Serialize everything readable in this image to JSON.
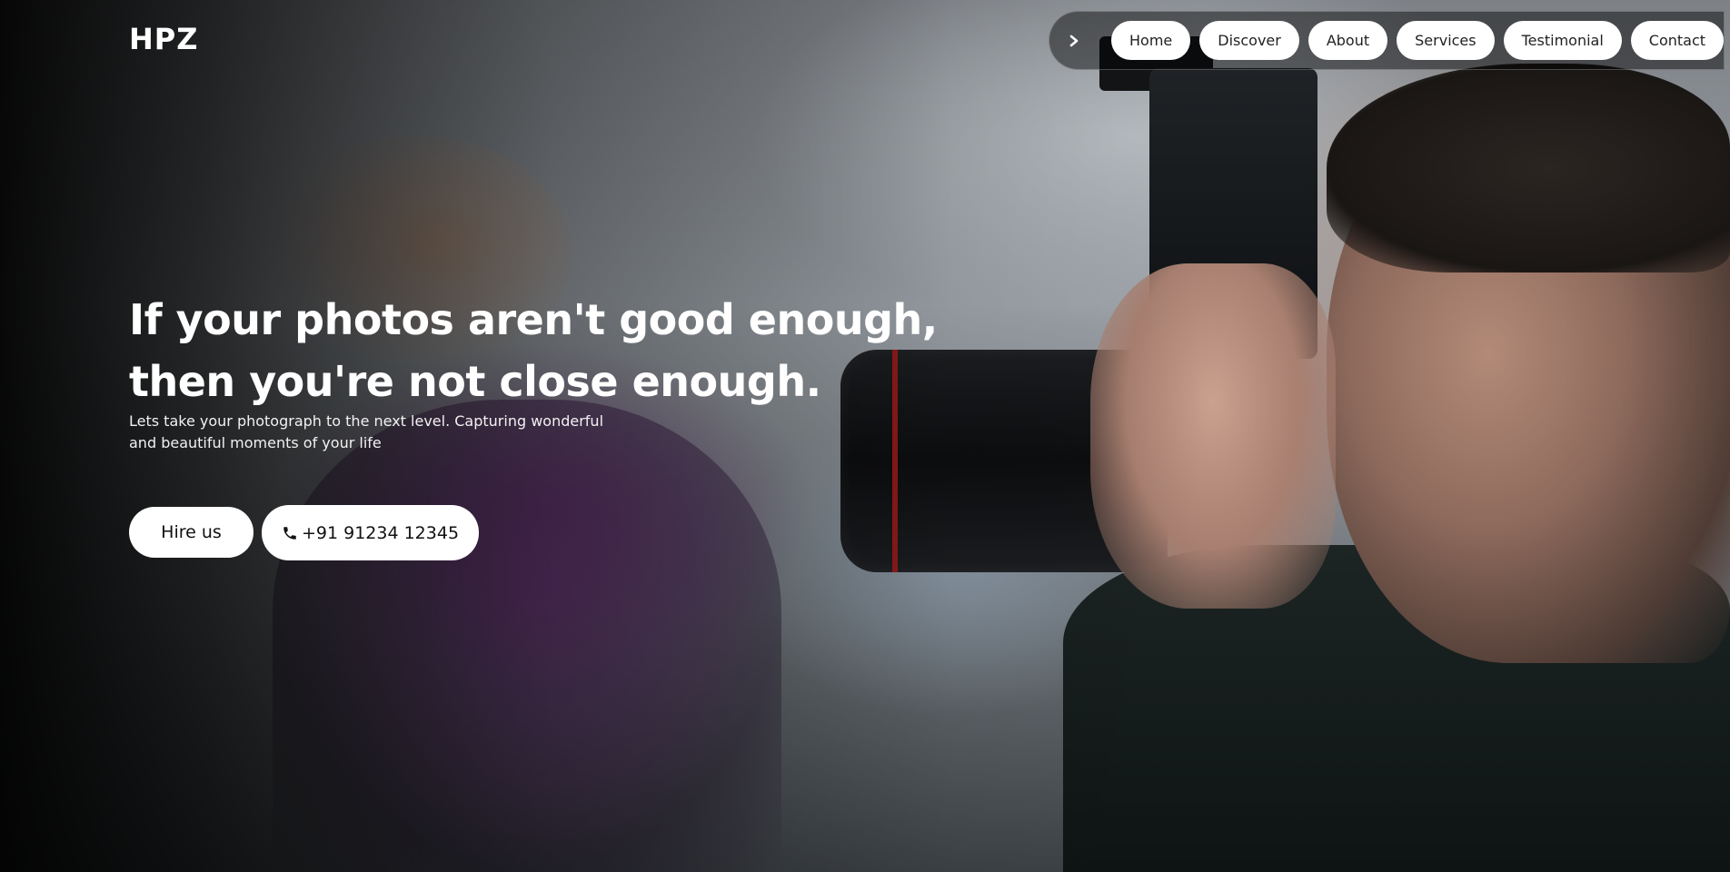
{
  "brand": "HPZ",
  "nav": {
    "toggle_icon": "chevron-right-icon",
    "items": [
      "Home",
      "Discover",
      "About",
      "Services",
      "Testimonial",
      "Contact"
    ]
  },
  "hero": {
    "headline_line1": "If your photos aren't good enough,",
    "headline_line2": "then you're not close enough.",
    "subtext": "Lets take your photograph to the next level. Capturing wonderful and beautiful moments of your life",
    "hire_label": "Hire us",
    "phone_label": "+91 91234 12345",
    "phone_icon": "phone-icon"
  }
}
